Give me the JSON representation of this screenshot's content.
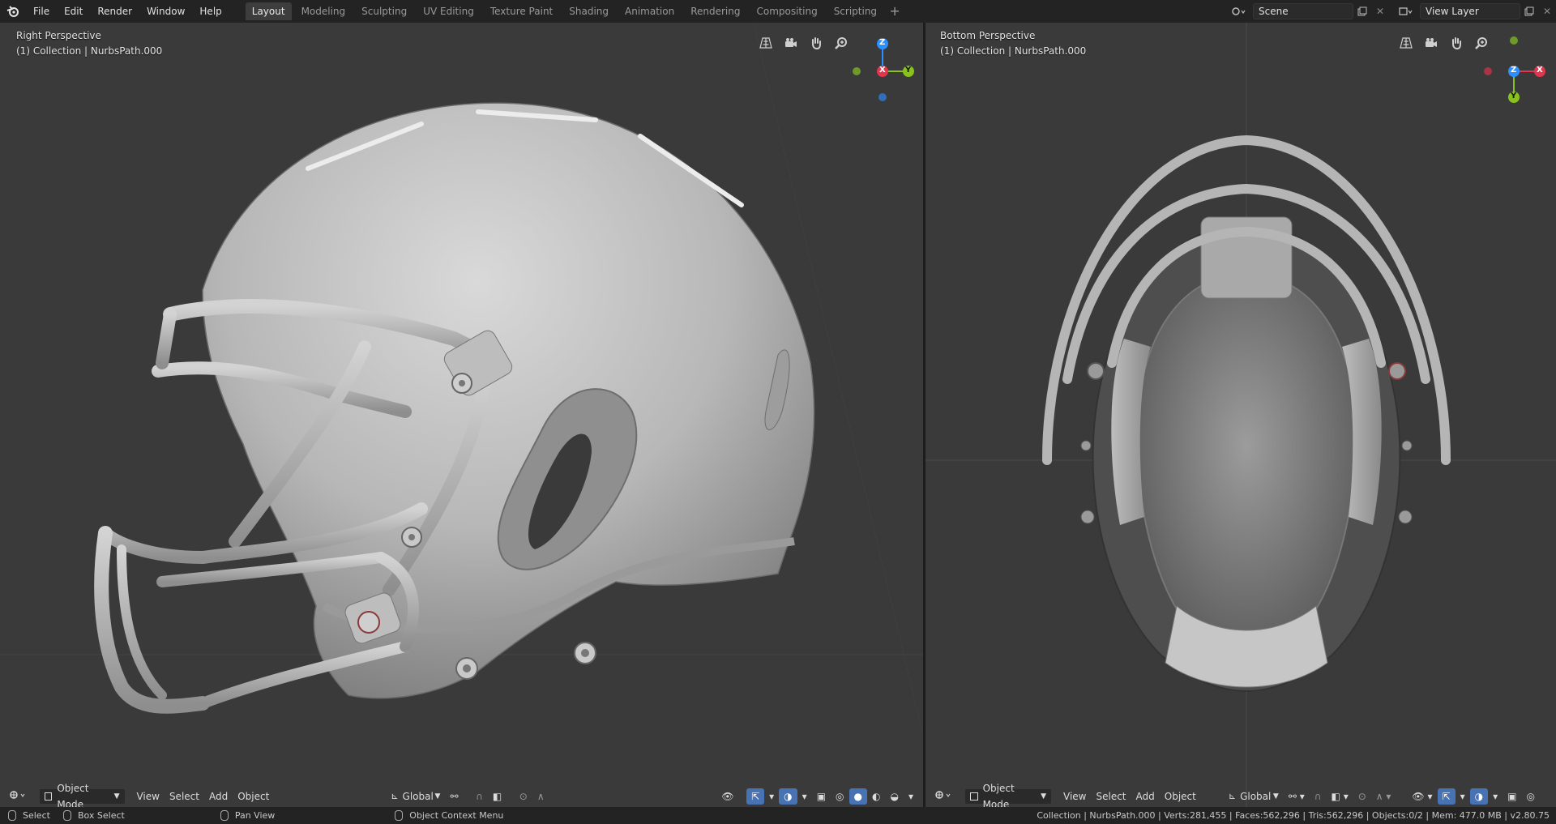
{
  "menu": [
    "File",
    "Edit",
    "Render",
    "Window",
    "Help"
  ],
  "workspaces": [
    "Layout",
    "Modeling",
    "Sculpting",
    "UV Editing",
    "Texture Paint",
    "Shading",
    "Animation",
    "Rendering",
    "Compositing",
    "Scripting"
  ],
  "active_workspace": "Layout",
  "scene": {
    "name": "Scene"
  },
  "view_layer": {
    "name": "View Layer"
  },
  "left_viewport": {
    "view_name": "Right Perspective",
    "collection": "(1) Collection | NurbsPath.000",
    "gizmo": {
      "z": "Z",
      "x": "X",
      "y": "Y"
    }
  },
  "right_viewport": {
    "view_name": "Bottom Perspective",
    "collection": "(1) Collection | NurbsPath.000",
    "gizmo": {
      "z": "Z",
      "x": "X",
      "y": "Y"
    }
  },
  "header": {
    "mode": "Object Mode",
    "view": "View",
    "select": "Select",
    "add": "Add",
    "object": "Object",
    "orientation": "Global"
  },
  "status": {
    "select": "Select",
    "box_select": "Box Select",
    "pan_view": "Pan View",
    "context_menu": "Object Context Menu",
    "stats": "Collection | NurbsPath.000 | Verts:281,455 | Faces:562,296 | Tris:562,296 | Objects:0/2 | Mem: 477.0 MB | v2.80.75"
  },
  "colors": {
    "x_axis": "#e0374f",
    "y_axis": "#8ac21d",
    "z_axis": "#2c8fff",
    "viewport_bg": "#3a3a3a",
    "active_tab": "#3d3d3d"
  }
}
